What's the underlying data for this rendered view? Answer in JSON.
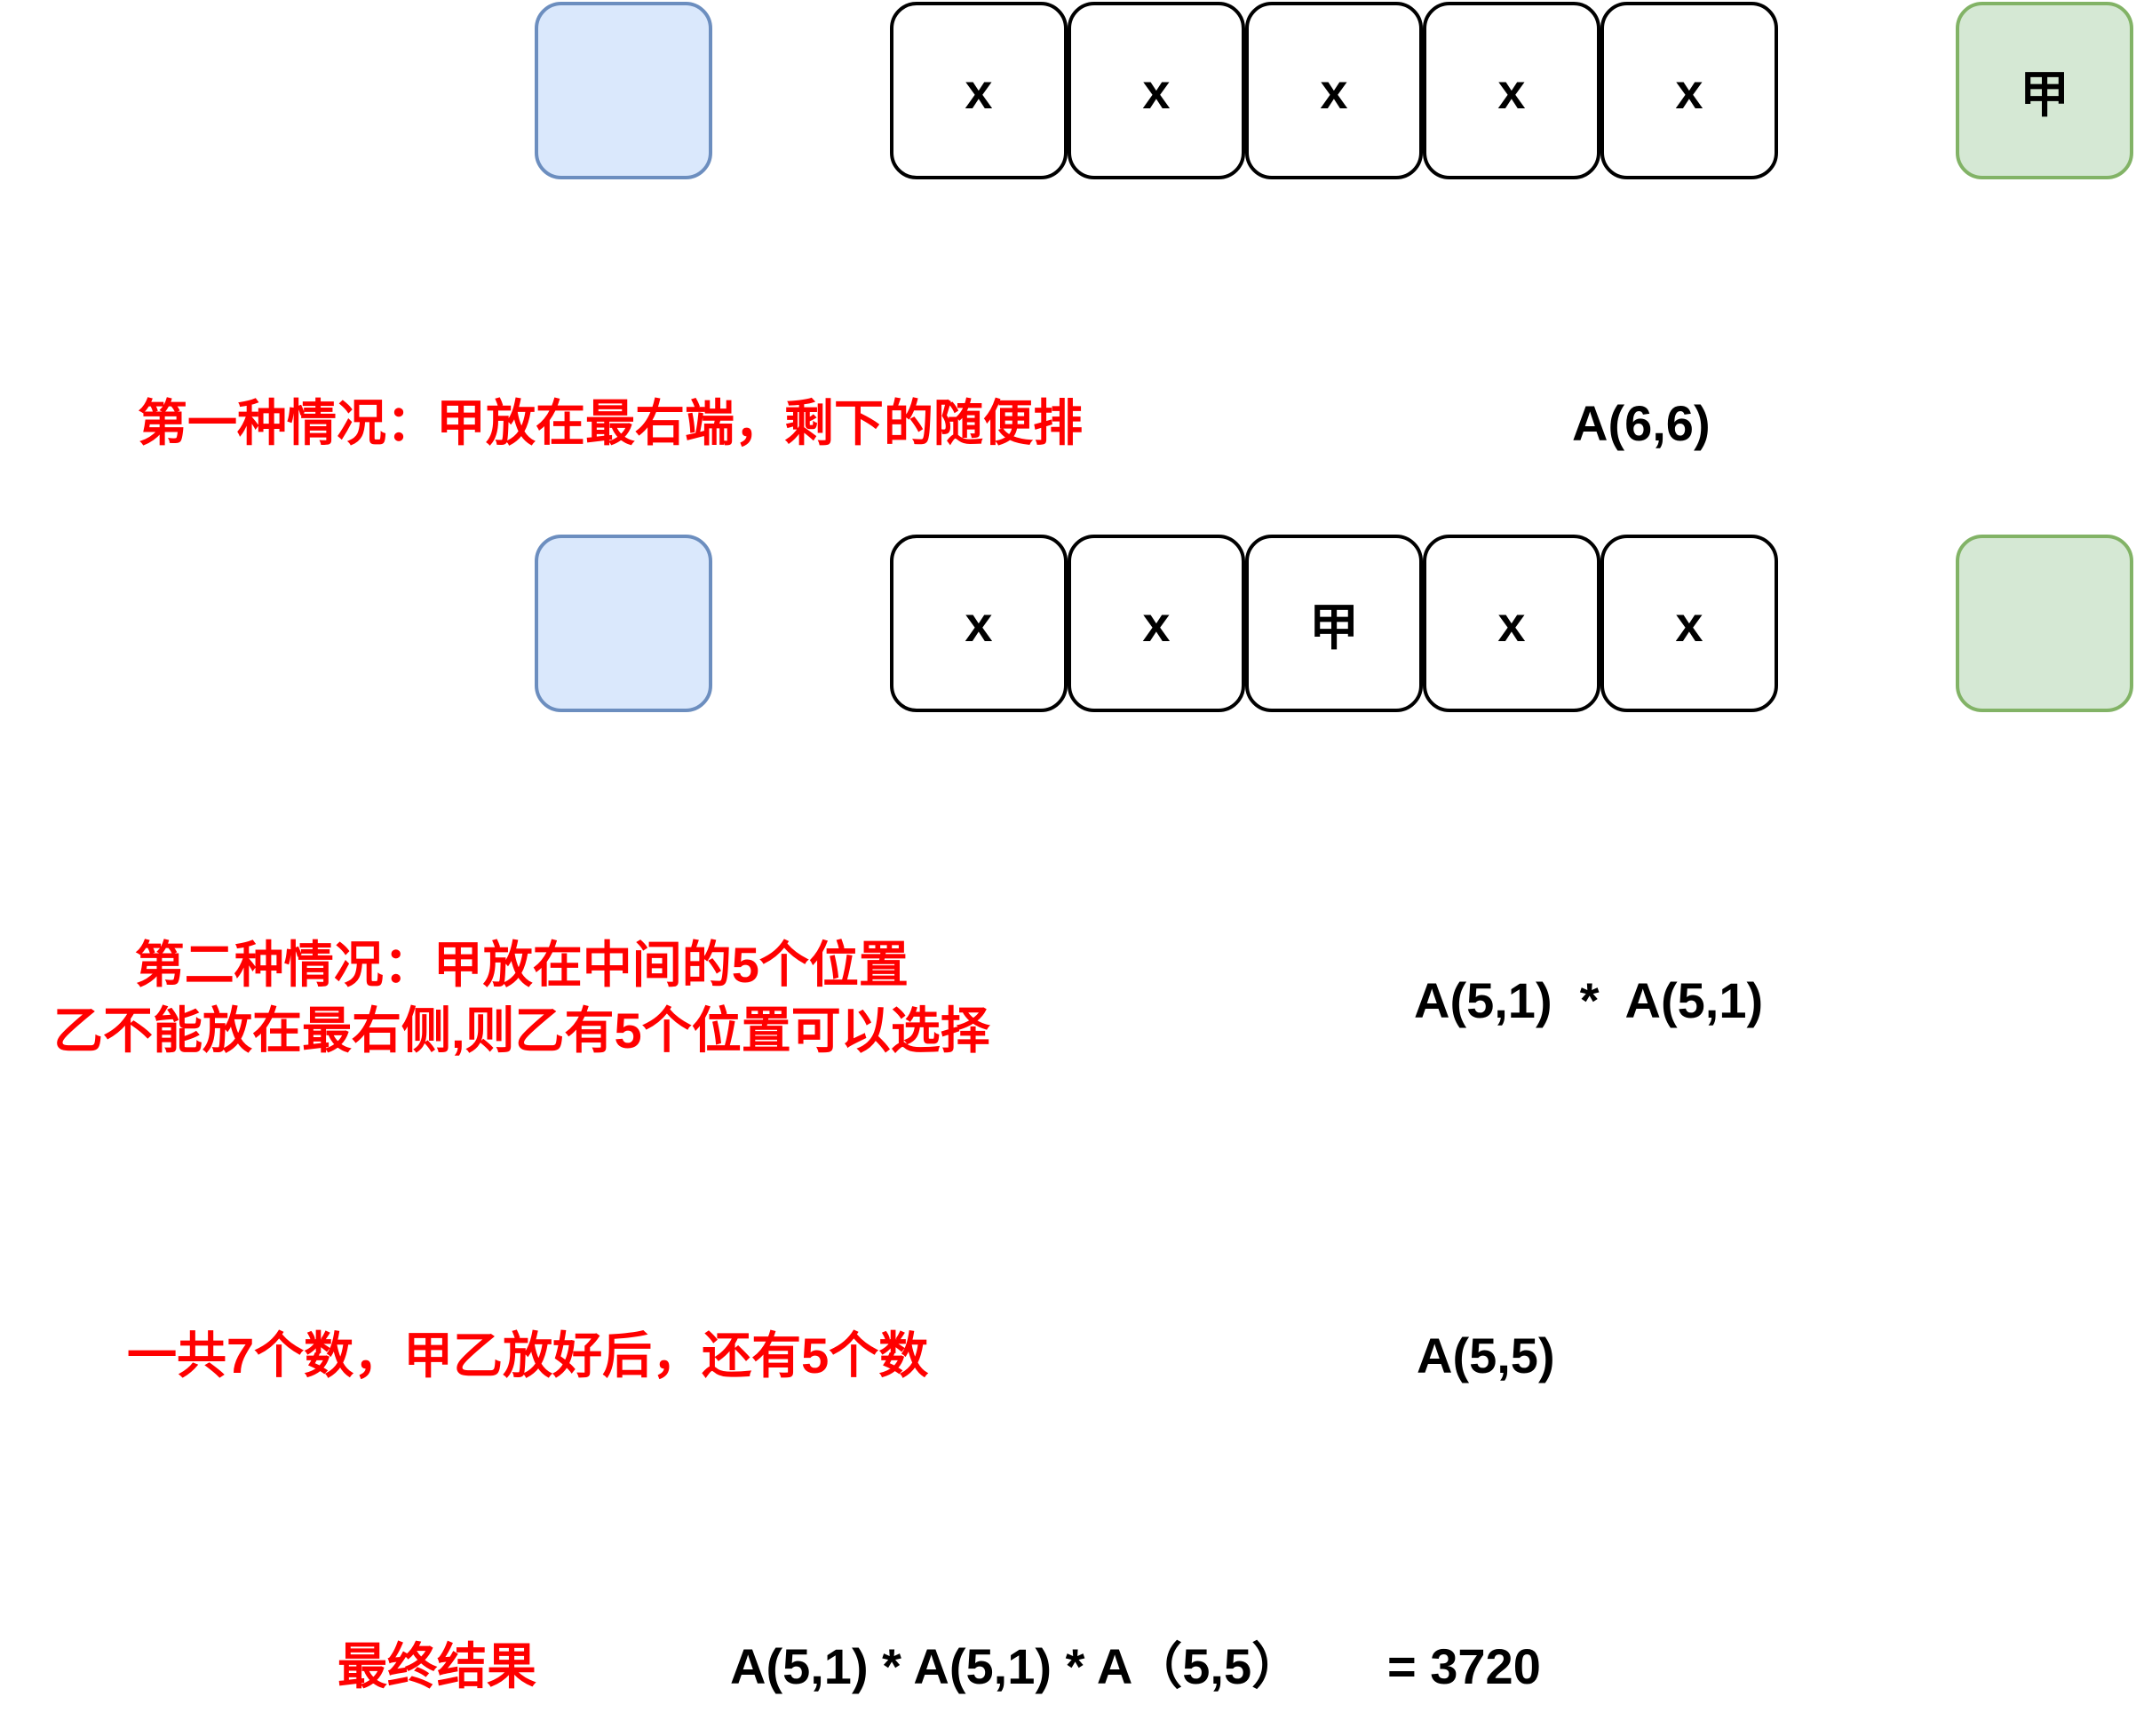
{
  "row1": {
    "cells": [
      "x",
      "x",
      "x",
      "x",
      "x"
    ],
    "right_box": "甲"
  },
  "row2": {
    "cells": [
      "x",
      "x",
      "甲",
      "x",
      "x"
    ],
    "right_box": ""
  },
  "case1": {
    "text": "第一种情况：甲放在最右端，剩下的随便排",
    "formula": "A(6,6)"
  },
  "case2": {
    "line1": "第二种情况：甲放在中间的5个位置",
    "line2": "乙不能放在最右侧,则乙有5个位置可以选择",
    "formula": "A(5,1)  *  A(5,1)"
  },
  "case3": {
    "text": "一共7个数，甲乙放好后，还有5个数",
    "formula": "A(5,5)"
  },
  "result": {
    "label": "最终结果",
    "formula": "A(5,1) * A(5,1) * A（5,5）",
    "value": "= 3720"
  },
  "colors": {
    "annotation_red": "#ff0000",
    "left_box_fill": "#dae8fc",
    "left_box_stroke": "#6c8ebf",
    "right_box_fill": "#d5e8d4",
    "right_box_stroke": "#82b366"
  }
}
